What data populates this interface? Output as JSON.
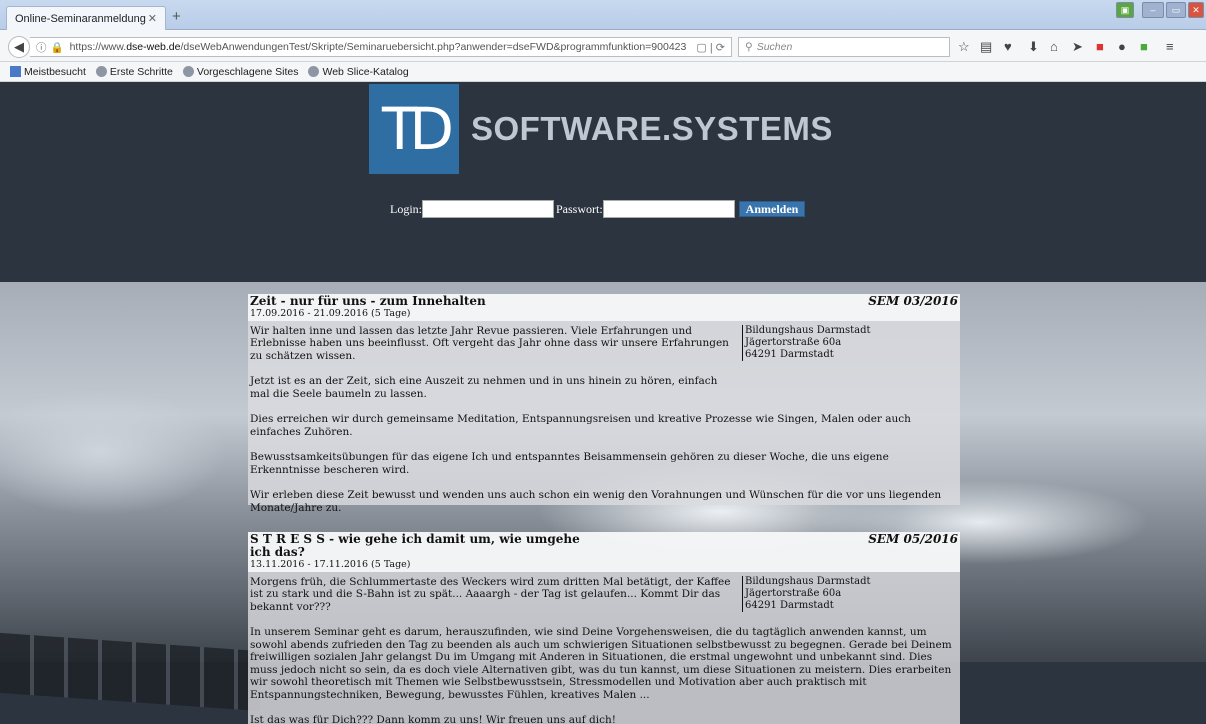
{
  "browser": {
    "tab_title": "Online-Seminaranmeldung",
    "url_prefix": "https://www.",
    "url_domain": "dse-web.de",
    "url_path": "/dseWebAnwendungenTest/Skripte/Seminaruebersicht.php?anwender=dseFWD&programmfunktion=900423",
    "search_placeholder": "Suchen",
    "bookmarks": [
      "Meistbesucht",
      "Erste Schritte",
      "Vorgeschlagene Sites",
      "Web Slice-Katalog"
    ]
  },
  "header": {
    "brand": "SOFTWARE.SYSTEMS",
    "login_label": "Login:",
    "password_label": "Passwort:",
    "submit_label": "Anmelden"
  },
  "seminars": [
    {
      "title": "Zeit - nur für uns - zum Innehalten",
      "code": "SEM 03/2016",
      "date": "17.09.2016 - 21.09.2016 (5 Tage)",
      "location": [
        "Bildungshaus Darmstadt",
        "Jägertorstraße 60a",
        "64291 Darmstadt"
      ],
      "paragraphs": [
        "Wir halten inne und lassen das letzte Jahr Revue passieren. Viele Erfahrungen und Erlebnisse haben uns beeinflusst. Oft vergeht das Jahr ohne dass wir unsere Erfahrungen zu schätzen wissen.",
        "Jetzt ist es an der Zeit, sich eine Auszeit zu nehmen und in uns hinein zu hören, einfach mal die Seele baumeln zu lassen.",
        "Dies erreichen wir durch gemeinsame Meditation, Entspannungsreisen und kreative Prozesse wie Singen, Malen oder auch einfaches Zuhören.",
        "Bewusstsamkeitsübungen für das eigene Ich und entspanntes Beisammensein gehören zu dieser Woche, die uns eigene Erkenntnisse bescheren wird.",
        "Wir erleben diese Zeit bewusst und wenden uns auch schon ein wenig den Vorahnungen und Wünschen für die vor uns liegenden Monate/Jahre zu."
      ]
    },
    {
      "title": "S T R E S S - wie gehe ich damit um, wie umgehe ich das?",
      "code": "SEM 05/2016",
      "date": "13.11.2016 - 17.11.2016 (5 Tage)",
      "location": [
        "Bildungshaus Darmstadt",
        "Jägertorstraße 60a",
        "64291 Darmstadt"
      ],
      "paragraphs": [
        "Morgens früh, die Schlummertaste des Weckers wird zum dritten Mal betätigt, der Kaffee ist zu stark und die S-Bahn ist zu spät... Aaaargh - der Tag ist gelaufen... Kommt Dir das bekannt vor???",
        "In unserem Seminar geht es darum, herauszufinden, wie sind Deine Vorgehensweisen, die du tagtäglich anwenden kannst, um sowohl abends zufrieden den Tag zu beenden als auch um schwierigen Situationen selbstbewusst zu begegnen. Gerade bei Deinem freiwilligen sozialen Jahr gelangst Du im Umgang mit Anderen in Situationen, die erstmal ungewohnt und unbekannt sind. Dies muss jedoch nicht so sein, da es doch viele Alternativen gibt, was du tun kannst, um diese Situationen zu meistern. Dies erarbeiten wir sowohl theoretisch mit Themen wie Selbstbewusstsein, Stressmodellen und Motivation aber auch praktisch mit Entspannungstechniken, Bewegung, bewusstes Fühlen, kreatives Malen ...",
        "Ist das was für Dich??? Dann komm zu uns! Wir freuen uns auf dich!"
      ]
    }
  ]
}
